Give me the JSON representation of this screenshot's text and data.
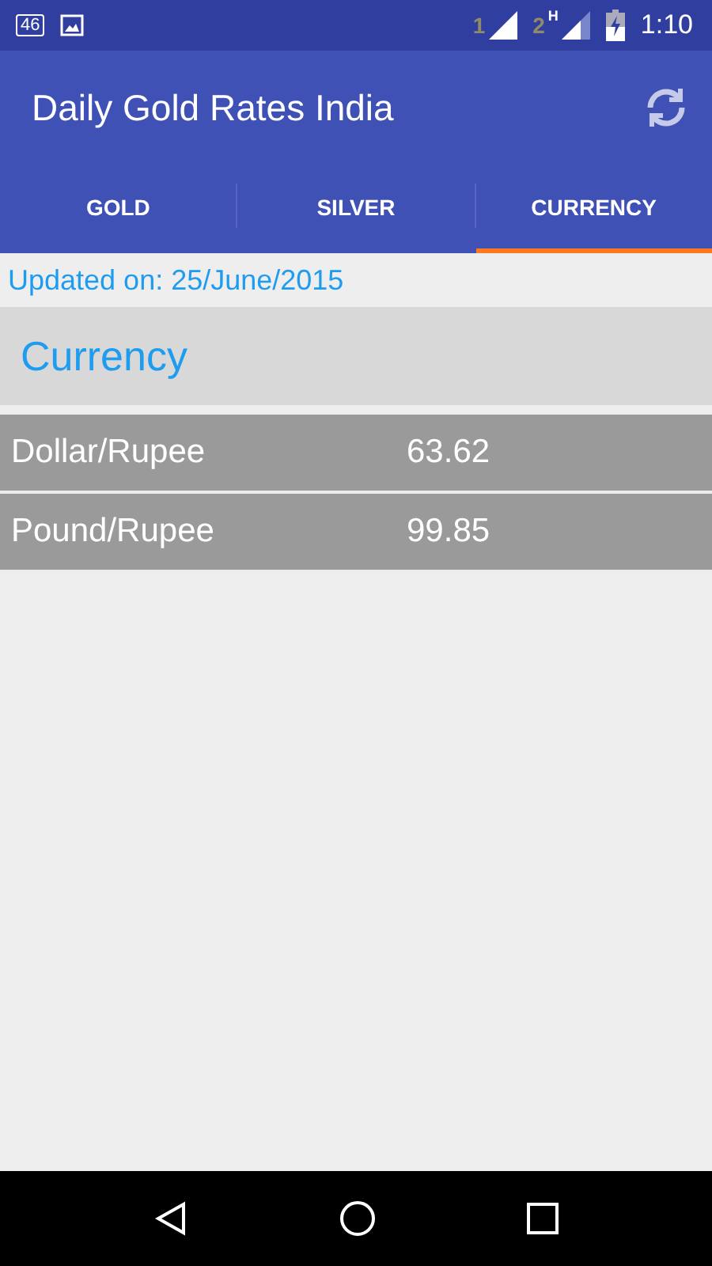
{
  "status_bar": {
    "network_badge": "46",
    "sim1_label": "1",
    "sim2_label": "2",
    "sim2_network": "H",
    "time": "1:10"
  },
  "app_bar": {
    "title": "Daily Gold Rates India"
  },
  "tabs": [
    {
      "label": "GOLD",
      "selected": false
    },
    {
      "label": "SILVER",
      "selected": false
    },
    {
      "label": "CURRENCY",
      "selected": true
    }
  ],
  "updated": "Updated on: 25/June/2015",
  "section_title": "Currency",
  "rates": [
    {
      "name": "Dollar/Rupee",
      "value": "63.62"
    },
    {
      "name": "Pound/Rupee",
      "value": "99.85"
    }
  ]
}
